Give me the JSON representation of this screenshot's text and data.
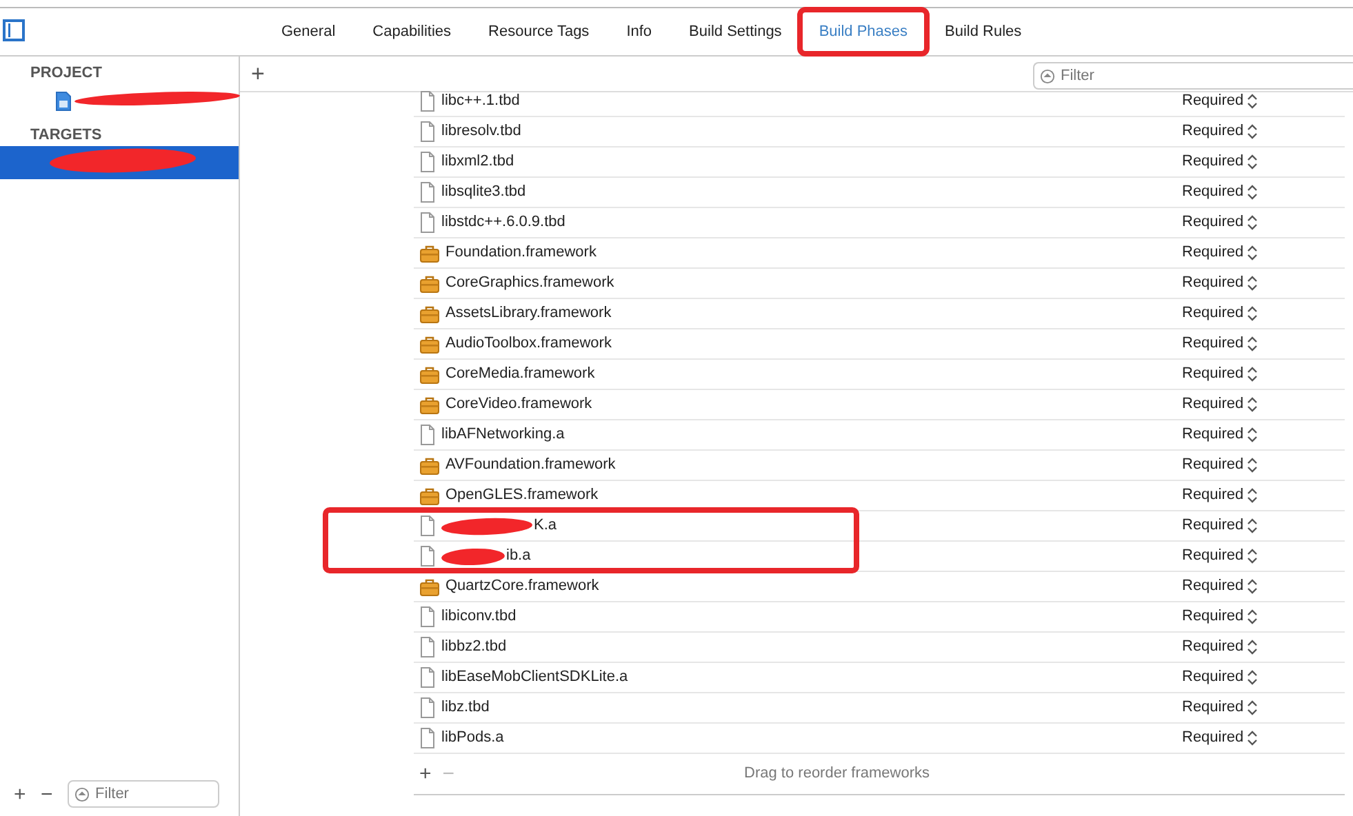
{
  "tabs": [
    {
      "label": "General",
      "selected": false,
      "highlighted": false
    },
    {
      "label": "Capabilities",
      "selected": false,
      "highlighted": false
    },
    {
      "label": "Resource Tags",
      "selected": false,
      "highlighted": false
    },
    {
      "label": "Info",
      "selected": false,
      "highlighted": false
    },
    {
      "label": "Build Settings",
      "selected": false,
      "highlighted": false
    },
    {
      "label": "Build Phases",
      "selected": true,
      "highlighted": true
    },
    {
      "label": "Build Rules",
      "selected": false,
      "highlighted": false
    }
  ],
  "sidebar": {
    "sections": [
      {
        "title": "PROJECT",
        "items": [
          {
            "kind": "project",
            "redacted": true,
            "selected": false
          }
        ]
      },
      {
        "title": "TARGETS",
        "items": [
          {
            "kind": "target",
            "redacted": true,
            "selected": true
          }
        ]
      }
    ],
    "filter": {
      "placeholder": "Filter"
    }
  },
  "toolbar": {
    "add": "+",
    "filter": {
      "placeholder": "Filter"
    }
  },
  "frameworks": [
    {
      "kind": "file",
      "name": "libc++.1.tbd",
      "status": "Required",
      "redacted": false,
      "highlighted": false
    },
    {
      "kind": "file",
      "name": "libresolv.tbd",
      "status": "Required",
      "redacted": false,
      "highlighted": false
    },
    {
      "kind": "file",
      "name": "libxml2.tbd",
      "status": "Required",
      "redacted": false,
      "highlighted": false
    },
    {
      "kind": "file",
      "name": "libsqlite3.tbd",
      "status": "Required",
      "redacted": false,
      "highlighted": false
    },
    {
      "kind": "file",
      "name": "libstdc++.6.0.9.tbd",
      "status": "Required",
      "redacted": false,
      "highlighted": false
    },
    {
      "kind": "framework",
      "name": "Foundation.framework",
      "status": "Required",
      "redacted": false,
      "highlighted": false
    },
    {
      "kind": "framework",
      "name": "CoreGraphics.framework",
      "status": "Required",
      "redacted": false,
      "highlighted": false
    },
    {
      "kind": "framework",
      "name": "AssetsLibrary.framework",
      "status": "Required",
      "redacted": false,
      "highlighted": false
    },
    {
      "kind": "framework",
      "name": "AudioToolbox.framework",
      "status": "Required",
      "redacted": false,
      "highlighted": false
    },
    {
      "kind": "framework",
      "name": "CoreMedia.framework",
      "status": "Required",
      "redacted": false,
      "highlighted": false
    },
    {
      "kind": "framework",
      "name": "CoreVideo.framework",
      "status": "Required",
      "redacted": false,
      "highlighted": false
    },
    {
      "kind": "file",
      "name": "libAFNetworking.a",
      "status": "Required",
      "redacted": false,
      "highlighted": false
    },
    {
      "kind": "framework",
      "name": "AVFoundation.framework",
      "status": "Required",
      "redacted": false,
      "highlighted": false
    },
    {
      "kind": "framework",
      "name": "OpenGLES.framework",
      "status": "Required",
      "redacted": false,
      "highlighted": false
    },
    {
      "kind": "file",
      "name": "K.a",
      "status": "Required",
      "redacted": true,
      "highlighted": true
    },
    {
      "kind": "file",
      "name": "ib.a",
      "status": "Required",
      "redacted": true,
      "highlighted": true
    },
    {
      "kind": "framework",
      "name": "QuartzCore.framework",
      "status": "Required",
      "redacted": false,
      "highlighted": false
    },
    {
      "kind": "file",
      "name": "libiconv.tbd",
      "status": "Required",
      "redacted": false,
      "highlighted": false
    },
    {
      "kind": "file",
      "name": "libbz2.tbd",
      "status": "Required",
      "redacted": false,
      "highlighted": false
    },
    {
      "kind": "file",
      "name": "libEaseMobClientSDKLite.a",
      "status": "Required",
      "redacted": false,
      "highlighted": false
    },
    {
      "kind": "file",
      "name": "libz.tbd",
      "status": "Required",
      "redacted": false,
      "highlighted": false
    },
    {
      "kind": "file",
      "name": "libPods.a",
      "status": "Required",
      "redacted": false,
      "highlighted": false
    }
  ],
  "list_footer": {
    "add": "+",
    "remove": "−",
    "hint": "Drag to reorder frameworks"
  },
  "sidebar_footer": {
    "add": "+",
    "remove": "−"
  }
}
